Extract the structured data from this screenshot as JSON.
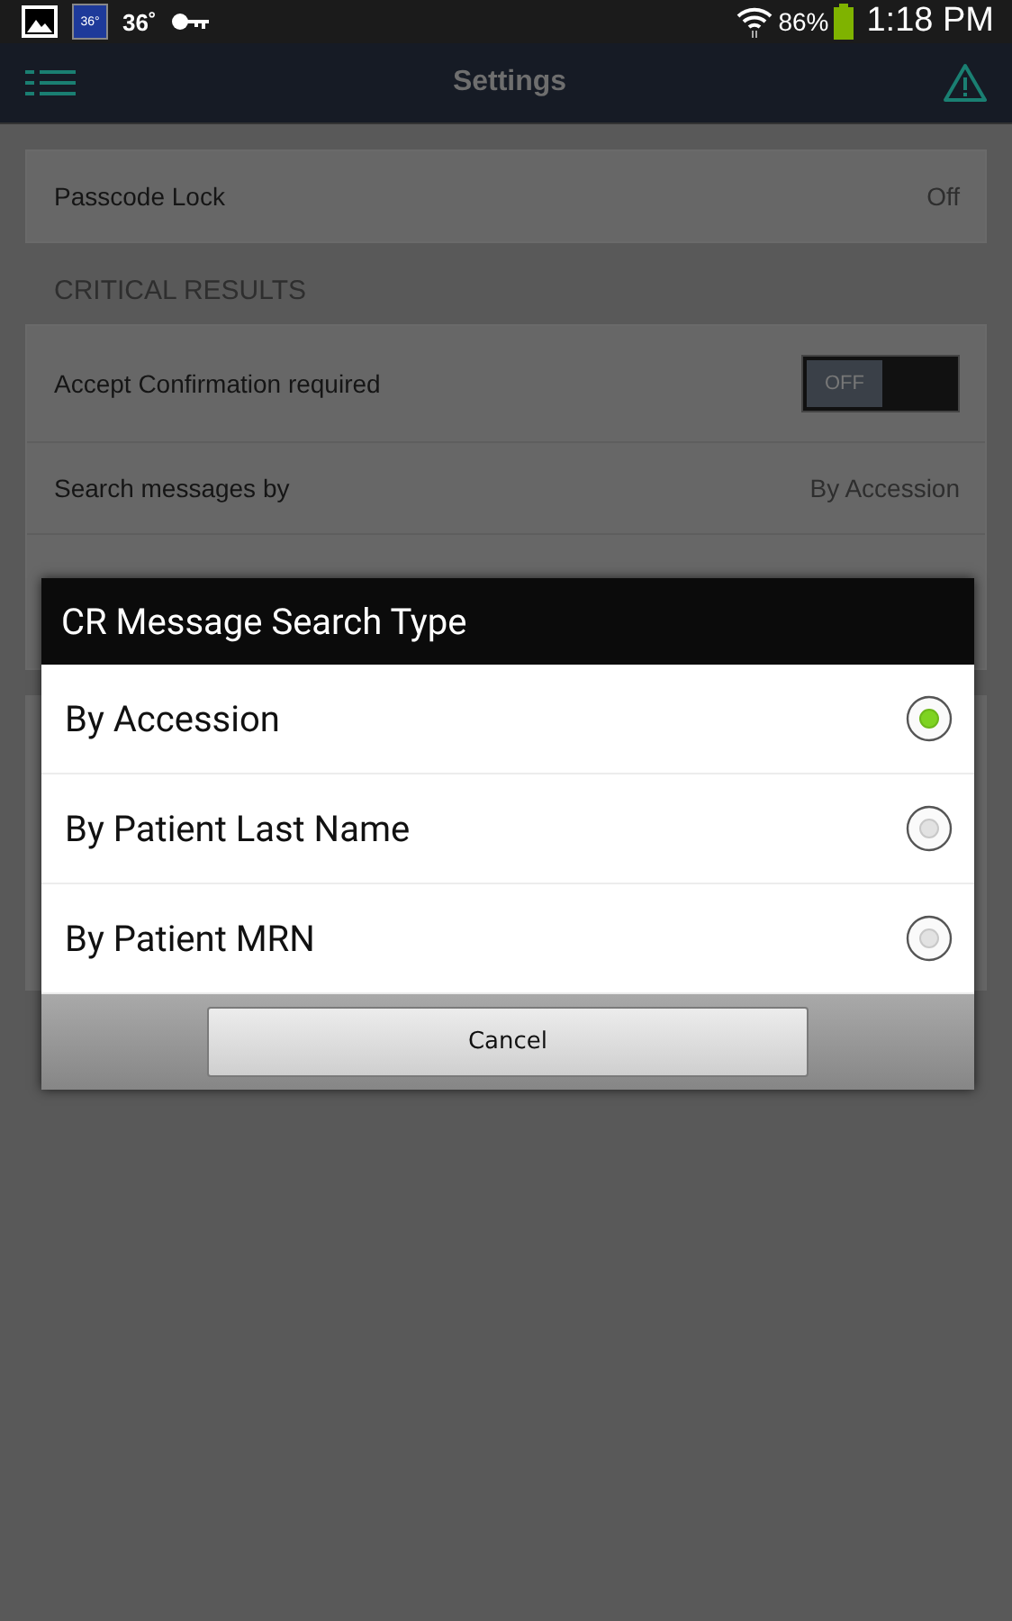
{
  "status_bar": {
    "weather_badge": "36°",
    "temperature": "36˚",
    "battery": "86%",
    "time": "1:18 PM"
  },
  "header": {
    "title": "Settings"
  },
  "settings": [
    {
      "label": "Passcode Lock",
      "value": "Off"
    }
  ],
  "section": {
    "title": "CRITICAL RESULTS"
  },
  "critical_results": [
    {
      "kind": "toggle",
      "label": "Accept Confirmation required",
      "on": false,
      "toggle_text": "OFF"
    },
    {
      "kind": "value",
      "label": "Search messages by",
      "value": "By Accession"
    }
  ],
  "dialog": {
    "title": "CR Message Search Type",
    "options": [
      {
        "label": "By Accession",
        "selected": true
      },
      {
        "label": "By Patient Last Name",
        "selected": false
      },
      {
        "label": "By Patient MRN",
        "selected": false
      }
    ],
    "button": "Cancel"
  }
}
